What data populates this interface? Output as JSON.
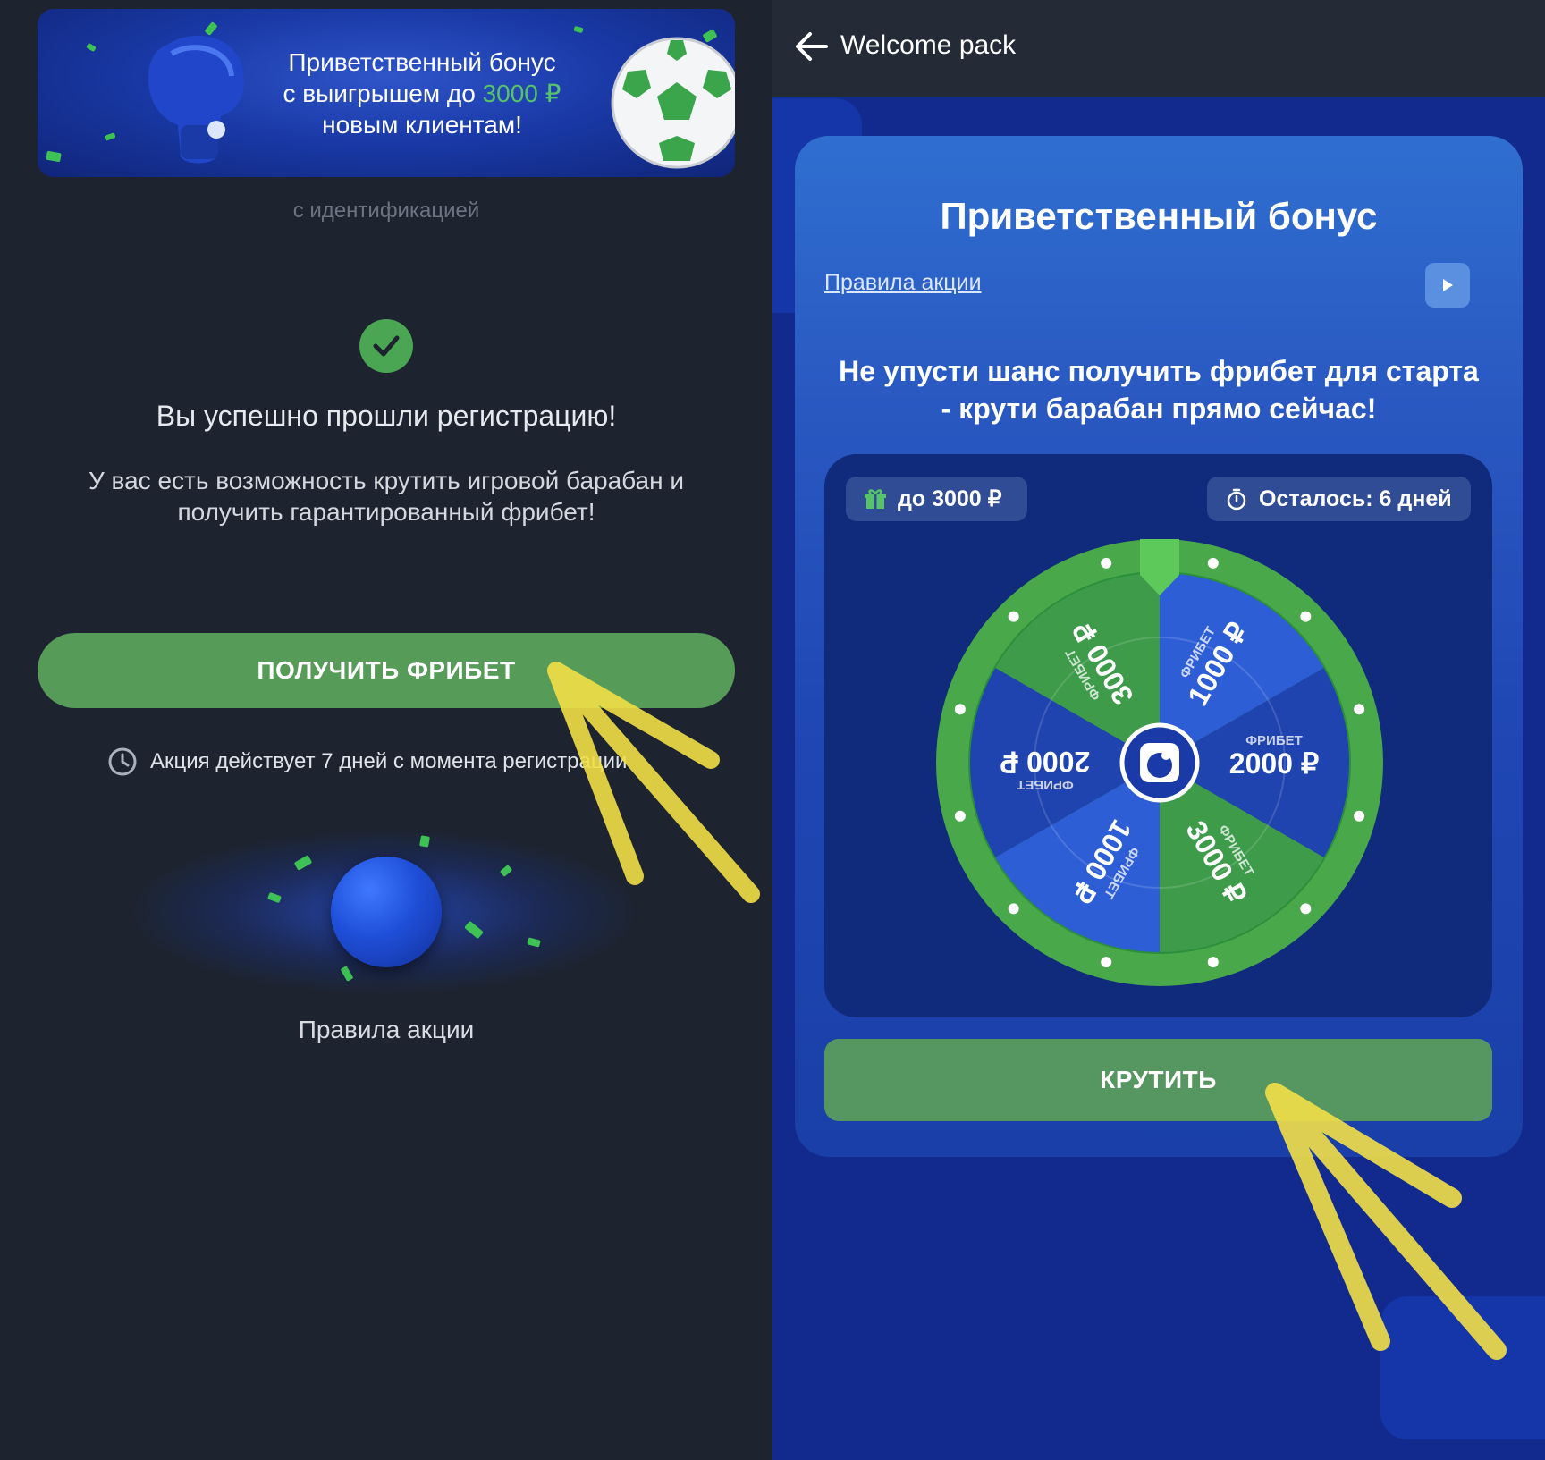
{
  "left": {
    "banner": {
      "line1": "Приветственный бонус",
      "line2_prefix": "с выигрышем до ",
      "line2_highlight": "3000 ₽",
      "line3": "новым клиентам!"
    },
    "subnote": "с идентификацией",
    "success_title": "Вы успешно прошли регистрацию!",
    "success_text": "У вас есть возможность крутить игровой барабан и получить гарантированный фрибет!",
    "get_freebet_button": "ПОЛУЧИТЬ ФРИБЕТ",
    "promo_note": "Акция действует 7 дней с момента регистрации",
    "rules_link": "Правила акции"
  },
  "right": {
    "topbar_title": "Welcome pack",
    "card_title": "Приветственный бонус",
    "rules_link": "Правила акции",
    "subtitle": "Не упусти шанс получить фрибет для старта - крути барабан прямо сейчас!",
    "chip_prize": "до 3000 ₽",
    "chip_time": "Осталось: 6 дней",
    "spin_button": "КРУТИТЬ",
    "wheel": {
      "segment_label": "ФРИБЕТ",
      "currency": "₽",
      "segments": [
        {
          "amount": "1000",
          "color": "#2d5ed6"
        },
        {
          "amount": "2000",
          "color": "#1f44b0"
        },
        {
          "amount": "3000",
          "color": "#3d9b4a"
        },
        {
          "amount": "1000",
          "color": "#2d5ed6"
        },
        {
          "amount": "2000",
          "color": "#1f44b0"
        },
        {
          "amount": "3000",
          "color": "#3d9b4a"
        }
      ]
    }
  },
  "colors": {
    "accent_green": "#56c26a",
    "button_green": "#579b58",
    "dark_bg": "#1d2430",
    "brand_blue": "#1a3fa8",
    "annotation_yellow": "#f2df47"
  }
}
